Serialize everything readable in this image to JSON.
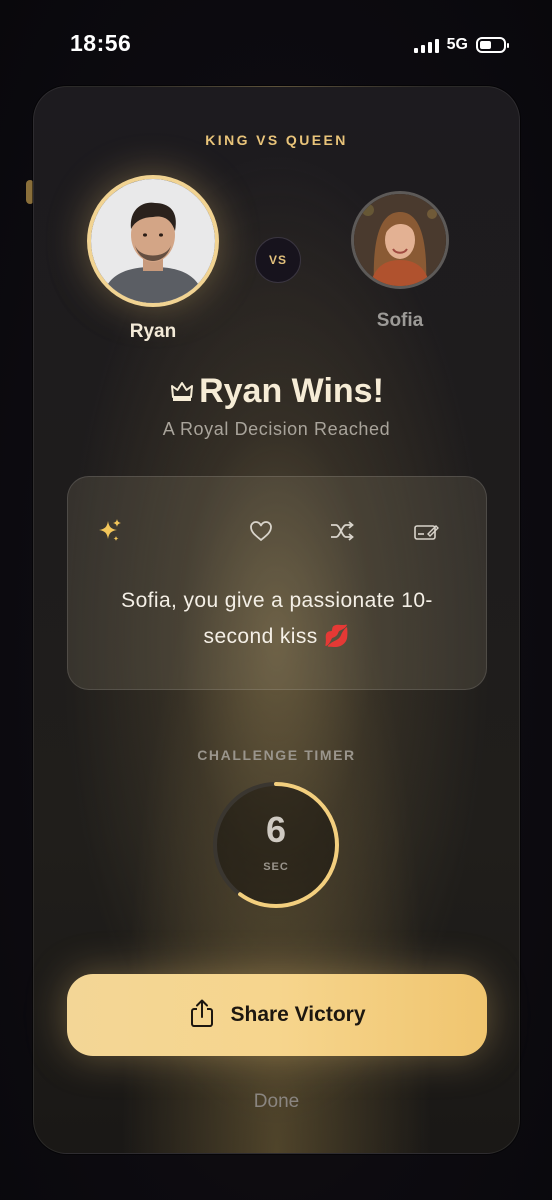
{
  "status_bar": {
    "time": "18:56",
    "network": "5G"
  },
  "header": {
    "eyebrow": "KING VS QUEEN"
  },
  "players": {
    "left": {
      "name": "Ryan"
    },
    "right": {
      "name": "Sofia"
    },
    "vs_label": "VS"
  },
  "result": {
    "title": "Ryan Wins!",
    "crown_icon": "crown-icon",
    "subtitle": "A Royal Decision Reached"
  },
  "challenge": {
    "icons": [
      "sparkle-icon",
      "heart-icon",
      "shuffle-icon",
      "edit-icon"
    ],
    "text": "Sofia, you give a passionate 10-second kiss 💋"
  },
  "timer": {
    "label": "CHALLENGE TIMER",
    "value": "6",
    "unit": "SEC",
    "progress": 0.6
  },
  "actions": {
    "share_label": "Share Victory",
    "done_label": "Done"
  },
  "colors": {
    "accent_gold": "#f1d392",
    "text_light": "#f6ecd6"
  }
}
